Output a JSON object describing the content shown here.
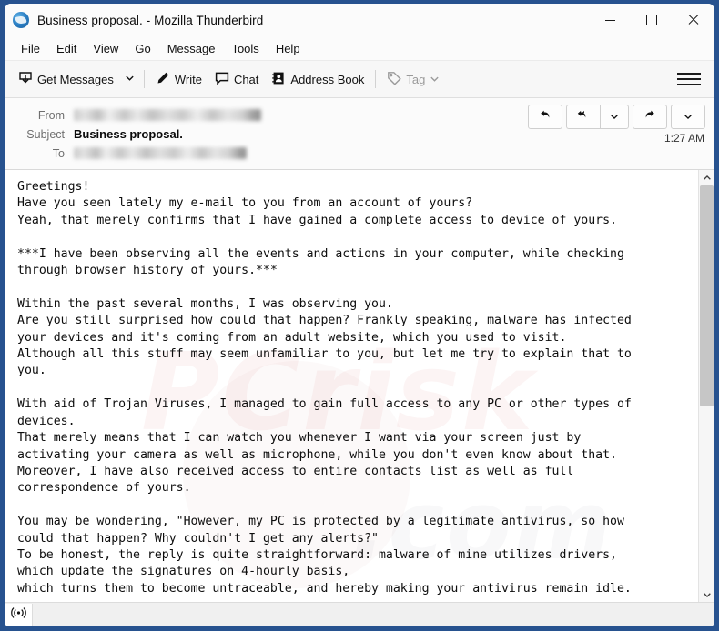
{
  "window": {
    "title": "Business proposal. - Mozilla Thunderbird",
    "logo_icon": "thunderbird-logo-icon",
    "controls": {
      "minimize": "minimize-icon",
      "maximize": "maximize-icon",
      "close": "close-icon"
    }
  },
  "menubar": {
    "items": [
      {
        "label": "File",
        "accesskey": "F"
      },
      {
        "label": "Edit",
        "accesskey": "E"
      },
      {
        "label": "View",
        "accesskey": "V"
      },
      {
        "label": "Go",
        "accesskey": "G"
      },
      {
        "label": "Message",
        "accesskey": "M"
      },
      {
        "label": "Tools",
        "accesskey": "T"
      },
      {
        "label": "Help",
        "accesskey": "H"
      }
    ]
  },
  "toolbar": {
    "get_messages_label": "Get Messages",
    "get_messages_icon": "inbox-download-icon",
    "get_messages_caret_icon": "chevron-down-icon",
    "write_label": "Write",
    "write_icon": "pencil-icon",
    "chat_label": "Chat",
    "chat_icon": "speech-bubble-icon",
    "address_book_label": "Address Book",
    "address_book_icon": "address-book-icon",
    "tag_label": "Tag",
    "tag_icon": "tag-icon",
    "tag_caret_icon": "chevron-down-icon",
    "tag_disabled": true,
    "app_menu_icon": "hamburger-menu-icon"
  },
  "message_header": {
    "from_label": "From",
    "from_value": "",
    "from_redacted": true,
    "subject_label": "Subject",
    "subject_value": "Business proposal.",
    "to_label": "To",
    "to_value": "",
    "to_redacted": true,
    "time": "1:27 AM",
    "actions": {
      "reply_icon": "reply-icon",
      "reply_all_icon": "reply-all-icon",
      "reply_all_caret_icon": "chevron-down-icon",
      "forward_icon": "forward-icon",
      "more_caret_icon": "chevron-down-icon"
    }
  },
  "message_body": {
    "text": "Greetings!\nHave you seen lately my e-mail to you from an account of yours?\nYeah, that merely confirms that I have gained a complete access to device of yours.\n\n***I have been observing all the events and actions in your computer, while checking\nthrough browser history of yours.***\n\nWithin the past several months, I was observing you.\nAre you still surprised how could that happen? Frankly speaking, malware has infected\nyour devices and it's coming from an adult website, which you used to visit.\nAlthough all this stuff may seem unfamiliar to you, but let me try to explain that to\nyou.\n\nWith aid of Trojan Viruses, I managed to gain full access to any PC or other types of\ndevices.\nThat merely means that I can watch you whenever I want via your screen just by\nactivating your camera as well as microphone, while you don't even know about that.\nMoreover, I have also received access to entire contacts list as well as full\ncorrespondence of yours.\n\nYou may be wondering, \"However, my PC is protected by a legitimate antivirus, so how\ncould that happen? Why couldn't I get any alerts?\"\nTo be honest, the reply is quite straightforward: malware of mine utilizes drivers,\nwhich update the signatures on 4-hourly basis,\nwhich turns them to become untraceable, and hereby making your antivirus remain idle."
  },
  "scrollbar": {
    "up_arrow_icon": "chevron-up-icon",
    "down_arrow_icon": "chevron-down-icon",
    "thumb_position_percent": 0
  },
  "statusbar": {
    "connection_icon": "broadcast-signal-icon",
    "status_text": ""
  },
  "colors": {
    "window_frame": "#27528f",
    "titlebar_bg": "#fbfbfb",
    "toolbar_bg": "#f7f7f7",
    "header_bg": "#fbfbfb",
    "body_bg": "#ffffff",
    "statusbar_bg": "#f0f0f0"
  }
}
